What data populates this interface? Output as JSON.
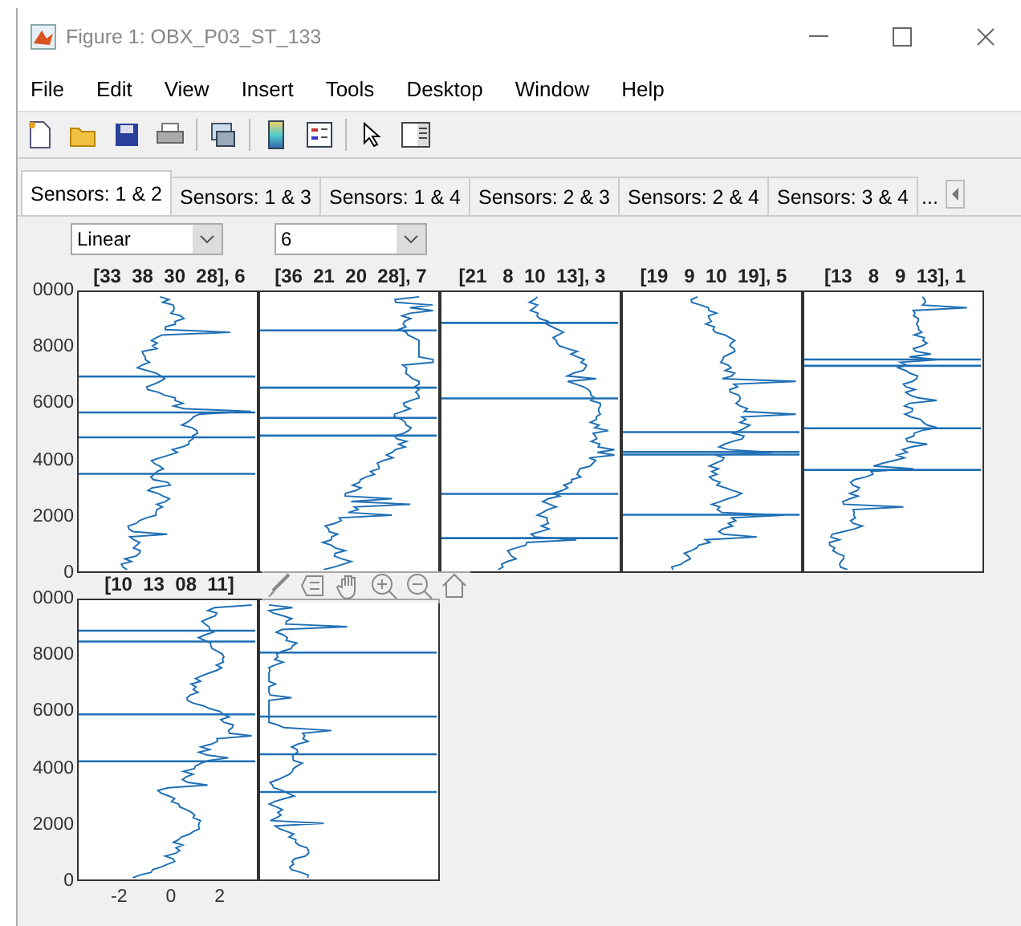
{
  "window": {
    "title": "Figure 1: OBX_P03_ST_133"
  },
  "menu": [
    "File",
    "Edit",
    "View",
    "Insert",
    "Tools",
    "Desktop",
    "Window",
    "Help"
  ],
  "tabs": [
    {
      "label": "Sensors: 1 & 2",
      "selected": true
    },
    {
      "label": "Sensors: 1 & 3",
      "selected": false
    },
    {
      "label": "Sensors: 1 & 4",
      "selected": false
    },
    {
      "label": "Sensors: 2 & 3",
      "selected": false
    },
    {
      "label": "Sensors: 2 & 4",
      "selected": false
    },
    {
      "label": "Sensors: 3 & 4",
      "selected": false
    }
  ],
  "tab_overflow": "...",
  "dropdowns": [
    {
      "value": "Linear"
    },
    {
      "value": "6"
    }
  ],
  "rows": [
    {
      "y_ticks": [
        "0000",
        "8000",
        "6000",
        "4000",
        "2000",
        "0"
      ],
      "plots": [
        {
          "kind": "axes",
          "title": "[33  38  30  28], 6"
        },
        {
          "kind": "axes",
          "title": "[36  21  20  28], 7"
        },
        {
          "kind": "axes",
          "title": "[21   8  10  13], 3"
        },
        {
          "kind": "axes",
          "title": "[19   9  10  19], 5"
        },
        {
          "kind": "axes",
          "title": "[13   8   9  13], 1"
        }
      ]
    },
    {
      "y_ticks": [
        "0000",
        "8000",
        "6000",
        "4000",
        "2000",
        "0"
      ],
      "x_ticks": [
        "-2",
        "0",
        "2"
      ],
      "plots": [
        {
          "kind": "axes",
          "title": "[10  13  08  11]"
        },
        {
          "kind": "axes"
        }
      ]
    }
  ]
}
